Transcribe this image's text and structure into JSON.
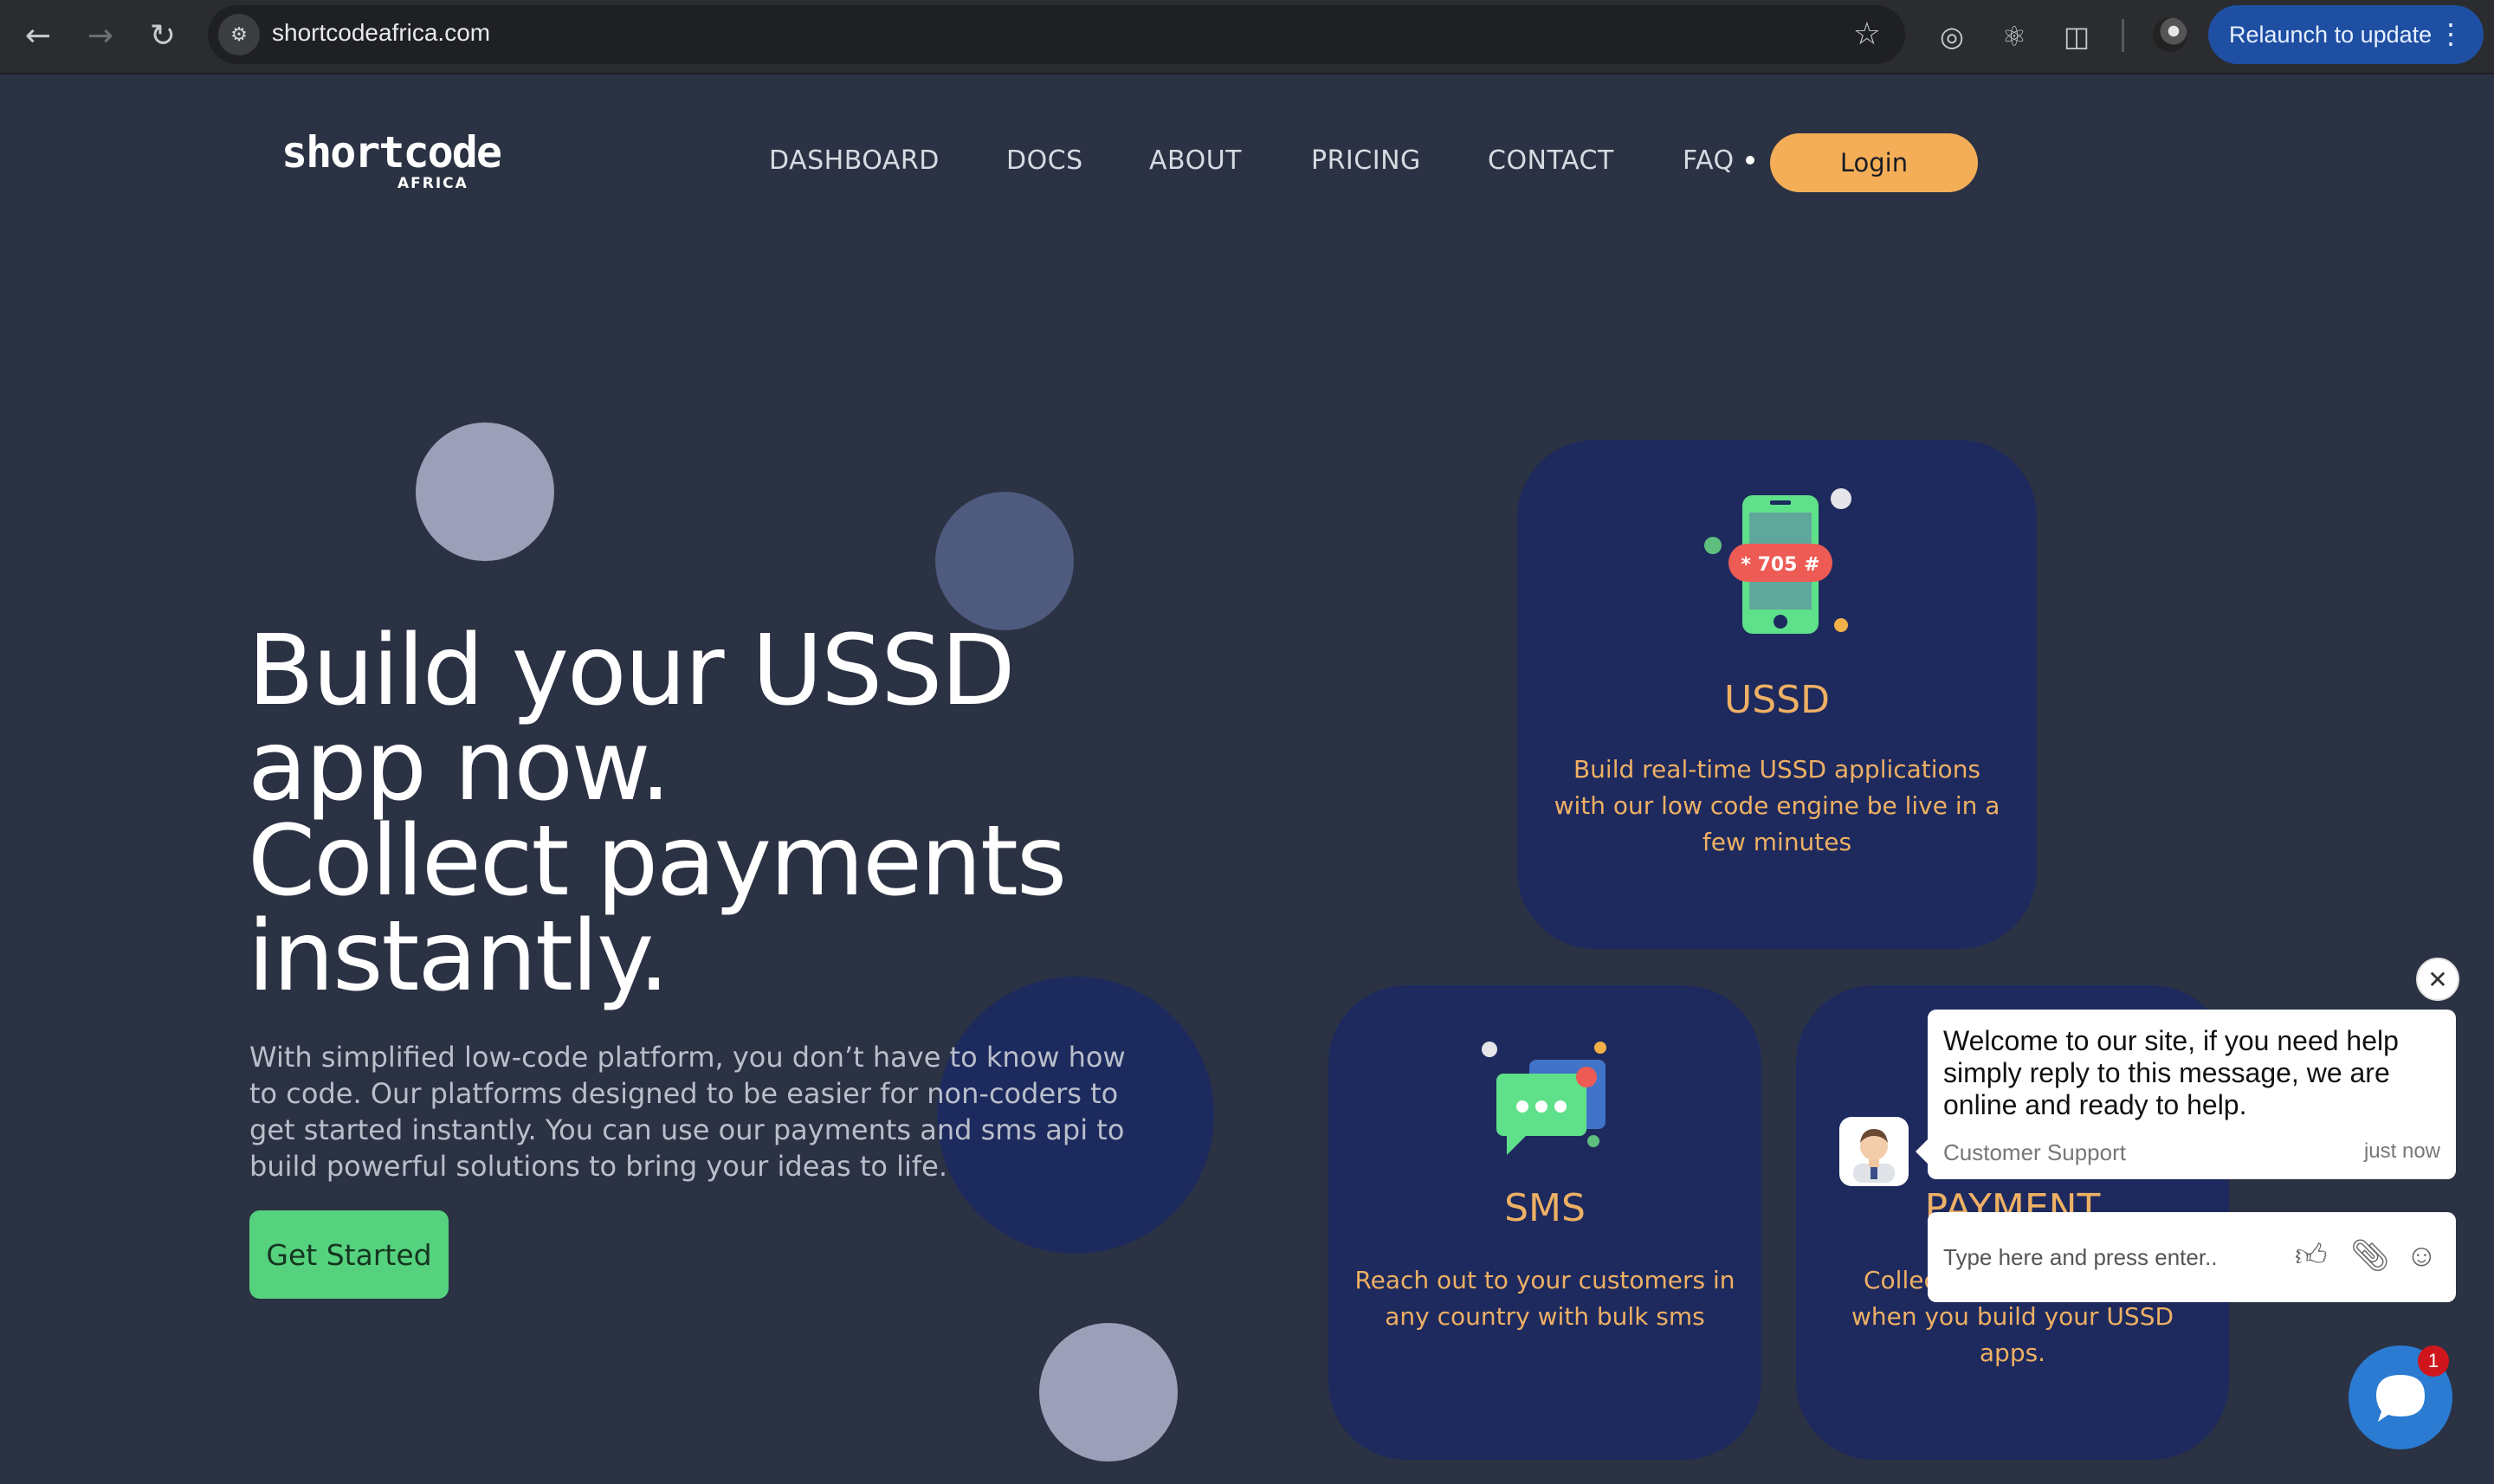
{
  "browser": {
    "url": "shortcodeafrica.com",
    "relaunch_label": "Relaunch to update",
    "icons": [
      "back-icon",
      "forward-icon",
      "reload-icon",
      "site-info-icon",
      "star-icon",
      "target-icon",
      "react-icon",
      "extensions-icon",
      "profile-avatar",
      "kebab-menu-icon"
    ]
  },
  "header": {
    "logo_main": "shortcode",
    "logo_sub": "AFRICA",
    "menu": [
      "DASHBOARD",
      "DOCS",
      "ABOUT",
      "PRICING",
      "CONTACT",
      "FAQ"
    ],
    "login_label": "Login"
  },
  "hero": {
    "title_lines": [
      "Build your USSD",
      "app now.",
      "Collect payments",
      "instantly."
    ],
    "description": "With simplified low-code platform, you don’t have to know how to code. Our platforms designed to be easier for non-coders to get started instantly. You can use our payments and sms api to build powerful solutions to bring your ideas to life.",
    "cta_label": "Get Started"
  },
  "cards": [
    {
      "title": "USSD",
      "icon": "phone-ussd-icon",
      "badge": "* 705 #",
      "description": "Build real-time USSD applications with our low code engine be live in a few minutes"
    },
    {
      "title": "SMS",
      "icon": "chat-sms-icon",
      "description": "Reach out to your customers in any country with bulk sms"
    },
    {
      "title": "PAYMENT",
      "icon": "payment-icon",
      "description": "Collect payments when you build your USSD apps.",
      "desc_line1_visible": "Collec",
      "desc_line2": "when you build your USSD",
      "desc_line3": "apps."
    }
  ],
  "chat": {
    "message": "Welcome to our site, if you need help simply reply to this message, we are online and ready to help.",
    "sender": "Customer Support",
    "time": "just now",
    "input_placeholder": "Type here and press enter..",
    "badge_count": "1"
  },
  "colors": {
    "page_bg": "#2b3243",
    "card_bg": "#1e2a5e",
    "accent_orange": "#f3ae57",
    "card_text": "#eeb064",
    "cta_green": "#56d27f",
    "chat_blue": "#2a7bd1"
  }
}
